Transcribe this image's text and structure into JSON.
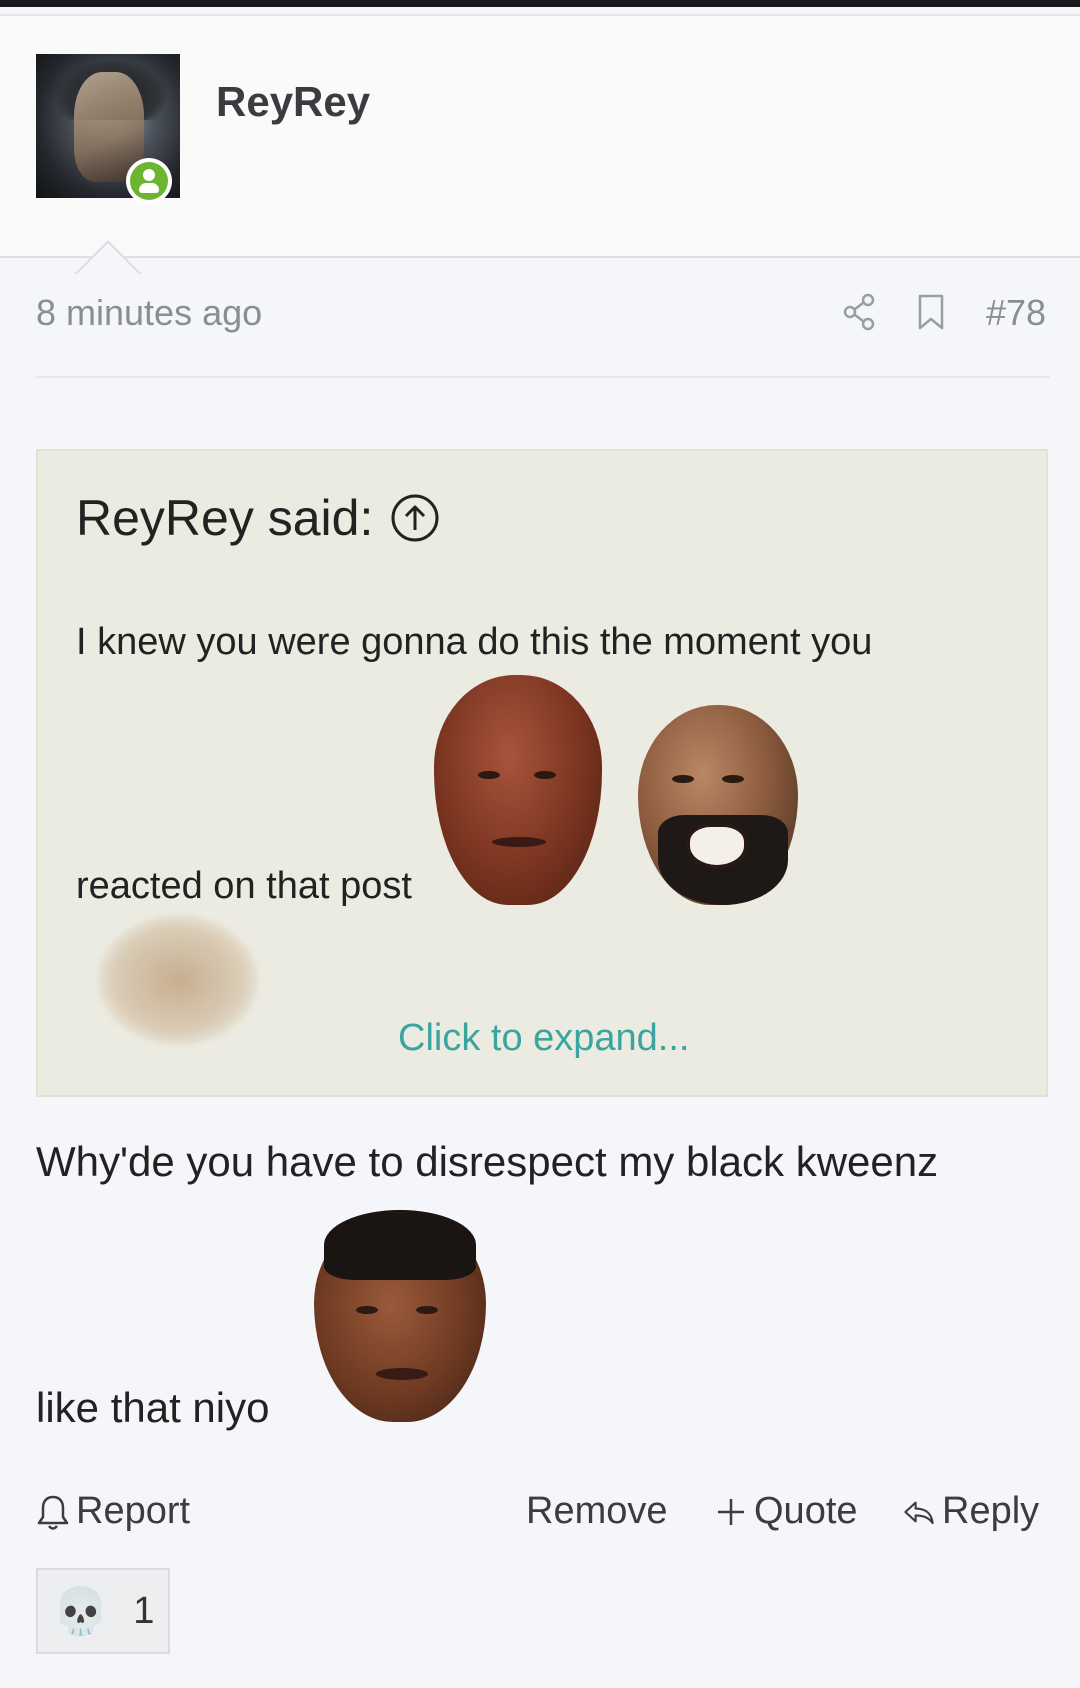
{
  "post": {
    "author": "ReyRey",
    "timestamp": "8 minutes ago",
    "number": "#78",
    "share_icon": "share-icon",
    "bookmark_icon": "bookmark-icon"
  },
  "quote": {
    "header": "ReyRey said:",
    "jump_icon": "arrow-up-circle-icon",
    "line1": "I knew you were gonna do this the moment you",
    "line2": "reacted on that post",
    "expand": "Click to expand..."
  },
  "reply": {
    "line1": "Why'de you have to disrespect my black kweenz",
    "line2": "like that niyo"
  },
  "actions": {
    "report": "Report",
    "remove": "Remove",
    "quote": "Quote",
    "reply": "Reply"
  },
  "reaction": {
    "emoji": "💀",
    "count": "1"
  },
  "colors": {
    "link": "#3aa59e",
    "online": "#6bb531",
    "quote_bg": "#ecebe1"
  }
}
